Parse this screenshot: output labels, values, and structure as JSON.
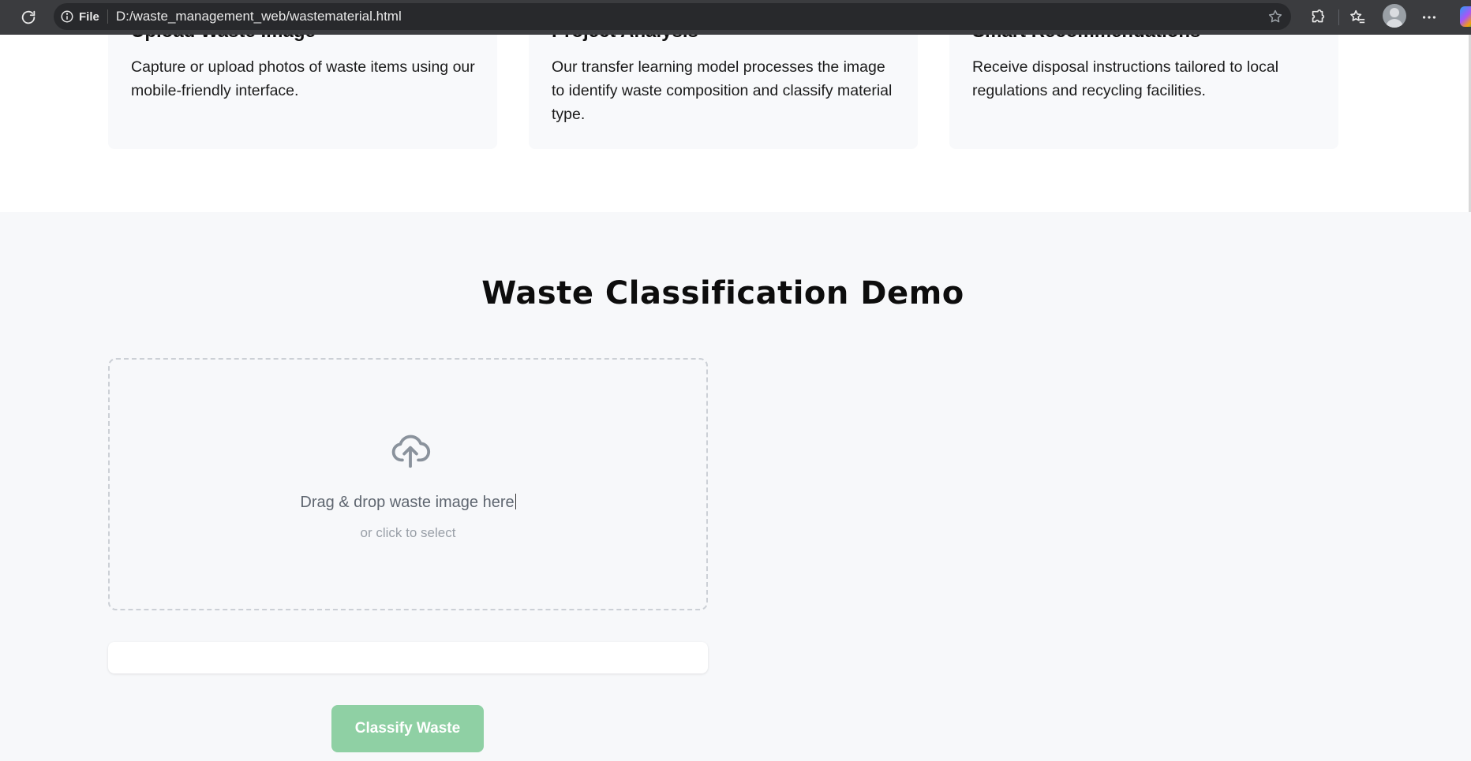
{
  "browser": {
    "site_info_label": "File",
    "url": "D:/waste_management_web/wastematerial.html"
  },
  "features": [
    {
      "title": "Upload Waste Image",
      "text": "Capture or upload photos of waste items using our mobile-friendly interface."
    },
    {
      "title": "Project Analysis",
      "text": "Our transfer learning model processes the image to identify waste composition and classify material type."
    },
    {
      "title": "Smart Recommendations",
      "text": "Receive disposal instructions tailored to local regulations and recycling facilities."
    }
  ],
  "demo": {
    "title": "Waste Classification Demo",
    "dropzone": {
      "icon": "cloud-upload-icon",
      "title": "Drag & drop waste image here",
      "subtitle": "or click to select"
    },
    "classify_button": "Classify Waste"
  },
  "colors": {
    "button_disabled": "#8fd0a4",
    "section_bg": "#f7f8fa",
    "chrome_bg": "#3b3c3f"
  }
}
